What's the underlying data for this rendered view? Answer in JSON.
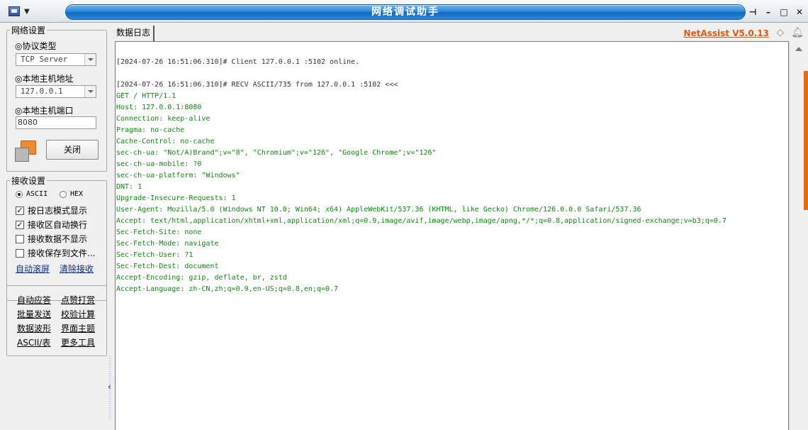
{
  "window": {
    "title": "网络调试助手"
  },
  "net_settings": {
    "legend": "网络设置",
    "protocol_label": "◎协议类型",
    "protocol_value": "TCP Server",
    "host_label": "◎本地主机地址",
    "host_value": "127.0.0.1",
    "port_label": "◎本地主机端口",
    "port_value": "8080",
    "close_button": "关闭"
  },
  "recv_settings": {
    "legend": "接收设置",
    "radio_ascii": "ASCII",
    "radio_hex": "HEX",
    "selected": "ASCII",
    "checks": [
      {
        "label": "按日志模式显示",
        "checked": true
      },
      {
        "label": "接收区自动换行",
        "checked": true
      },
      {
        "label": "接收数据不显示",
        "checked": false
      },
      {
        "label": "接收保存到文件...",
        "checked": false
      }
    ],
    "link_auto_scroll": "自动滚屏",
    "link_clear": "清除接收"
  },
  "tools": {
    "items": [
      "自动应答",
      "点赞打赏",
      "批量发送",
      "校验计算",
      "数据波形",
      "界面主题",
      "ASCII/表",
      "更多工具"
    ]
  },
  "tab": {
    "label": "数据日志"
  },
  "brand": {
    "label": "NetAssist V5.0.13",
    "color": "#e05a0c"
  },
  "log": {
    "lines": [
      {
        "kind": "sys",
        "text": "[2024-07-26 16:51:06.310]# Client 127.0.0.1 :5102 online."
      },
      {
        "kind": "sys",
        "text": "[2024-07-26 16:51:06.310]# RECV ASCII/735 from 127.0.0.1 :5102 <<<"
      },
      {
        "kind": "recv",
        "text": "GET / HTTP/1.1"
      },
      {
        "kind": "recv",
        "text": "Host: 127.0.0.1:8080"
      },
      {
        "kind": "recv",
        "text": "Connection: keep-alive"
      },
      {
        "kind": "recv",
        "text": "Pragma: no-cache"
      },
      {
        "kind": "recv",
        "text": "Cache-Control: no-cache"
      },
      {
        "kind": "recv",
        "text": "sec-ch-ua: \"Not/A)Brand\";v=\"8\", \"Chromium\";v=\"126\", \"Google Chrome\";v=\"126\""
      },
      {
        "kind": "recv",
        "text": "sec-ch-ua-mobile: ?0"
      },
      {
        "kind": "recv",
        "text": "sec-ch-ua-platform: \"Windows\""
      },
      {
        "kind": "recv",
        "text": "DNT: 1"
      },
      {
        "kind": "recv",
        "text": "Upgrade-Insecure-Requests: 1"
      },
      {
        "kind": "recv",
        "text": "User-Agent: Mozilla/5.0 (Windows NT 10.0; Win64; x64) AppleWebKit/537.36 (KHTML, like Gecko) Chrome/126.0.0.0 Safari/537.36"
      },
      {
        "kind": "recv",
        "text": "Accept: text/html,application/xhtml+xml,application/xml;q=0.9,image/avif,image/webp,image/apng,*/*;q=0.8,application/signed-exchange;v=b3;q=0.7"
      },
      {
        "kind": "recv",
        "text": "Sec-Fetch-Site: none"
      },
      {
        "kind": "recv",
        "text": "Sec-Fetch-Mode: navigate"
      },
      {
        "kind": "recv",
        "text": "Sec-Fetch-User: ?1"
      },
      {
        "kind": "recv",
        "text": "Sec-Fetch-Dest: document"
      },
      {
        "kind": "recv",
        "text": "Accept-Encoding: gzip, deflate, br, zstd"
      },
      {
        "kind": "recv",
        "text": "Accept-Language: zh-CN,zh;q=0.9,en-US;q=0.8,en;q=0.7"
      }
    ]
  }
}
